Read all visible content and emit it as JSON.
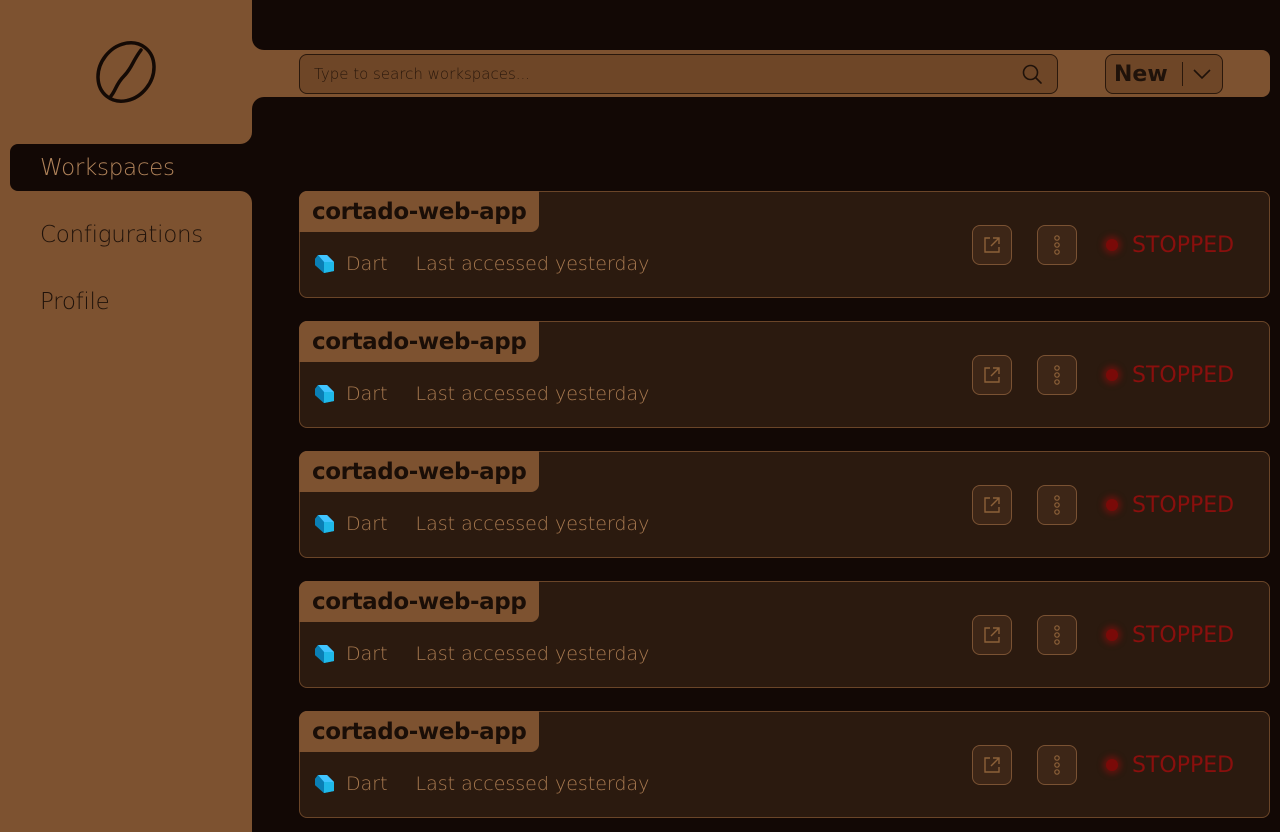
{
  "sidebar": {
    "items": [
      {
        "label": "Workspaces",
        "active": true
      },
      {
        "label": "Configurations",
        "active": false
      },
      {
        "label": "Profile",
        "active": false
      }
    ]
  },
  "header": {
    "search_placeholder": "Type to search workspaces...",
    "new_label": "New"
  },
  "workspaces": [
    {
      "name": "cortado-web-app",
      "language": "Dart",
      "last_accessed": "Last accessed yesterday",
      "status": "STOPPED"
    },
    {
      "name": "cortado-web-app",
      "language": "Dart",
      "last_accessed": "Last accessed yesterday",
      "status": "STOPPED"
    },
    {
      "name": "cortado-web-app",
      "language": "Dart",
      "last_accessed": "Last accessed yesterday",
      "status": "STOPPED"
    },
    {
      "name": "cortado-web-app",
      "language": "Dart",
      "last_accessed": "Last accessed yesterday",
      "status": "STOPPED"
    },
    {
      "name": "cortado-web-app",
      "language": "Dart",
      "last_accessed": "Last accessed yesterday",
      "status": "STOPPED"
    }
  ],
  "colors": {
    "sidebar": "#7d5230",
    "background": "#120805",
    "card": "#2b1a0f",
    "status_stopped": "#8a0f0d"
  },
  "icons": {
    "logo": "coffee-bean-icon",
    "search": "search-icon",
    "dropdown": "chevron-down-icon",
    "open": "external-link-icon",
    "more": "more-vertical-icon",
    "language": "dart-icon"
  }
}
